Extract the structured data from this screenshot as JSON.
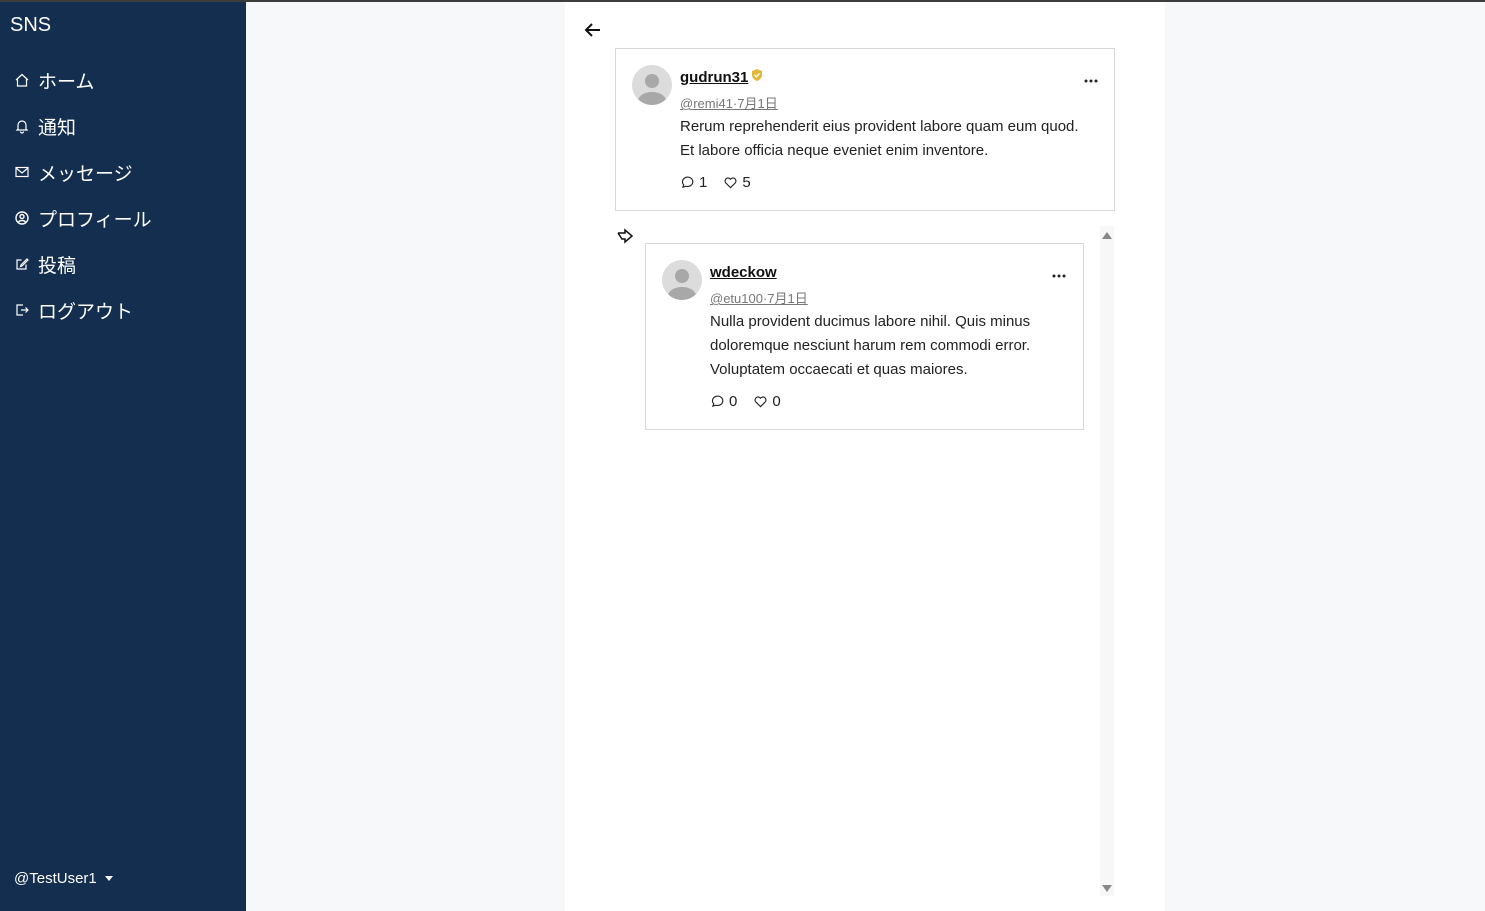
{
  "app": {
    "title": "SNS"
  },
  "sidebar": {
    "items": [
      {
        "label": "ホーム",
        "icon": "home-icon"
      },
      {
        "label": "通知",
        "icon": "bell-icon"
      },
      {
        "label": "メッセージ",
        "icon": "envelope-icon"
      },
      {
        "label": "プロフィール",
        "icon": "person-circle-icon"
      },
      {
        "label": "投稿",
        "icon": "pencil-square-icon"
      },
      {
        "label": "ログアウト",
        "icon": "logout-icon"
      }
    ],
    "user": "@TestUser1"
  },
  "thread": {
    "main_post": {
      "username": "gudrun31",
      "verified": true,
      "meta": "@remi41·7月1日",
      "body": "Rerum reprehenderit eius provident labore quam eum quod. Et labore officia neque eveniet enim inventore.",
      "replies": "1",
      "likes": "5"
    },
    "reply_post": {
      "username": "wdeckow",
      "meta": "@etu100·7月1日",
      "body": "Nulla provident ducimus labore nihil. Quis minus doloremque nesciunt harum rem commodi error. Voluptatem occaecati et quas maiores.",
      "replies": "0",
      "likes": "0"
    }
  },
  "colors": {
    "sidebar_bg": "#132e4e",
    "verified_badge": "#e0b93b"
  }
}
